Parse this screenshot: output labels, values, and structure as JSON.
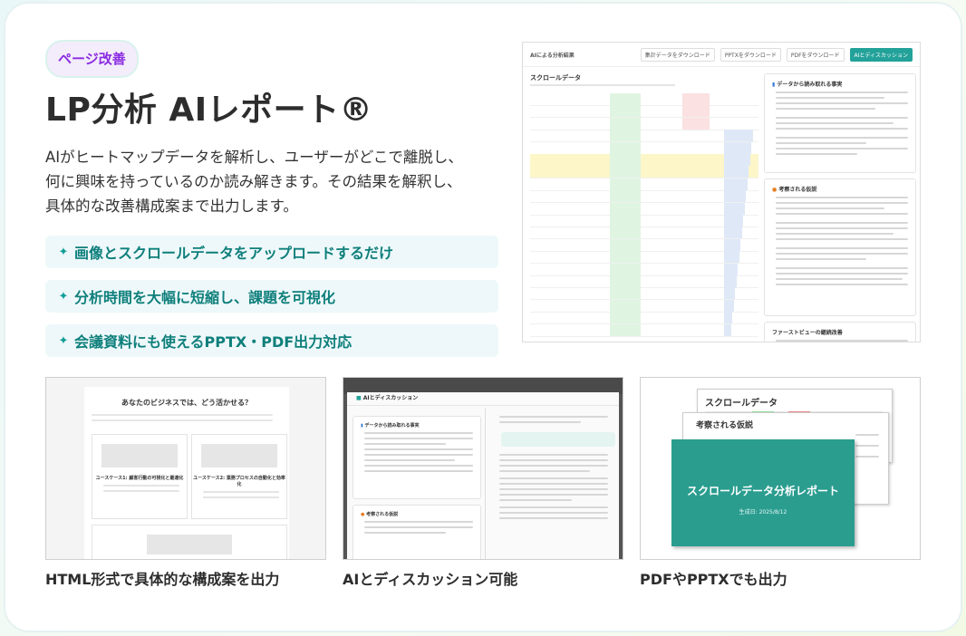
{
  "badge": "ページ改善",
  "title": "LP分析 AIレポート®",
  "description": [
    "AIがヒートマップデータを解析し、ユーザーがどこで離脱し、",
    "何に興味を持っているのか読み解きます。その結果を解釈し、",
    "具体的な改善構成案まで出力します。"
  ],
  "features": [
    "画像とスクロールデータをアップロードするだけ",
    "分析時間を大幅に短縮し、課題を可視化",
    "会議資料にも使えるPPTX・PDF出力対応"
  ],
  "feature_icon": "sparkle-icon",
  "screenshot": {
    "window_title": "AIによる分析結果",
    "buttons": [
      "集計データをダウンロード",
      "PPTXをダウンロード",
      "PDFをダウンロード",
      "AIとディスカッション"
    ],
    "section_title": "スクロールデータ",
    "panel1_title": "データから読み取れる事実",
    "panel2_title": "考察される仮説",
    "panel3_title": "ファーストビューの継続改善"
  },
  "thumbs": [
    {
      "caption": "HTML形式で具体的な構成案を出力",
      "heading": "あなたのビジネスでは、どう活かせる？",
      "case1": "ユースケース1: 顧客行動の可視化と最適化",
      "case2": "ユースケース2: 業務プロセスの自動化と効率化"
    },
    {
      "caption": "AIとディスカッション可能",
      "heading": "AIとディスカッション",
      "panel1": "データから読み取れる事実",
      "panel2": "考察される仮説"
    },
    {
      "caption": "PDFやPPTXでも出力",
      "slide1": "スクロールデータ",
      "slide2": "考察される仮説",
      "slide3": "スクロールデータ分析レポート",
      "slide3_date": "生成日: 2025/8/12"
    }
  ],
  "colors": {
    "accent": "#129e97",
    "badge_text": "#8a2be2",
    "slide_teal": "#2a9d8f"
  }
}
